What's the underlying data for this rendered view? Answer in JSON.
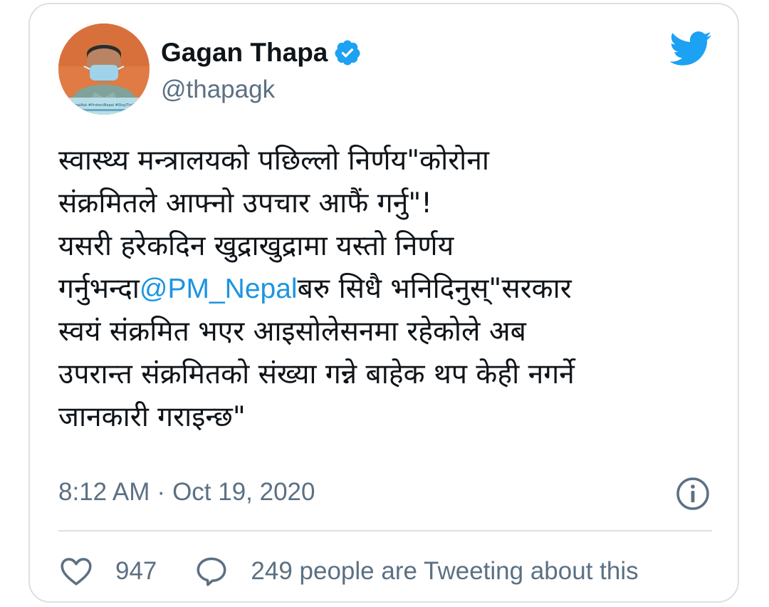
{
  "author": {
    "display_name": "Gagan Thapa",
    "handle": "@thapagk",
    "verified": true,
    "avatar_banner_text": "#NepalAsk #ProtectNepal #StayTheTask"
  },
  "tweet": {
    "lines": [
      {
        "parts": [
          {
            "text": "स्वास्थ्य मन्त्रालयको पछिल्लो निर्णय\"कोरोना"
          }
        ]
      },
      {
        "parts": [
          {
            "text": "संक्रमितले आफ्नो उपचार आफैं गर्नु\"!"
          }
        ]
      },
      {
        "parts": [
          {
            "text": "यसरी हरेकदिन खुद्राखुद्रामा यस्तो निर्णय"
          }
        ]
      },
      {
        "parts": [
          {
            "text": "गर्नुभन्दा"
          },
          {
            "text": "@PM_Nepal",
            "mention": true
          },
          {
            "text": "बरु सिधै भनिदिनुस्\"सरकार"
          }
        ]
      },
      {
        "parts": [
          {
            "text": "स्वयं संक्रमित भएर आइसोलेसनमा रहेकोले अब"
          }
        ]
      },
      {
        "parts": [
          {
            "text": "उपरान्त संक्रमितको संख्या गन्ने बाहेक थप केही नगर्ने"
          }
        ]
      },
      {
        "parts": [
          {
            "text": "जानकारी गराइन्छ\""
          }
        ]
      }
    ],
    "time": "8:12 AM",
    "separator": "·",
    "date": "Oct 19, 2020"
  },
  "stats": {
    "likes": "947",
    "tweeting_text": "249 people are Tweeting about this"
  },
  "colors": {
    "brand_blue": "#1da1f2",
    "mention_blue": "#1b95e0",
    "text_primary": "#0f1419",
    "text_secondary": "#5b7083",
    "border": "#dbe1e6"
  },
  "icons": {
    "brand": "twitter-bird-icon",
    "verified": "verified-badge-icon",
    "info": "info-icon",
    "like": "heart-icon",
    "reply": "speech-bubble-icon"
  }
}
